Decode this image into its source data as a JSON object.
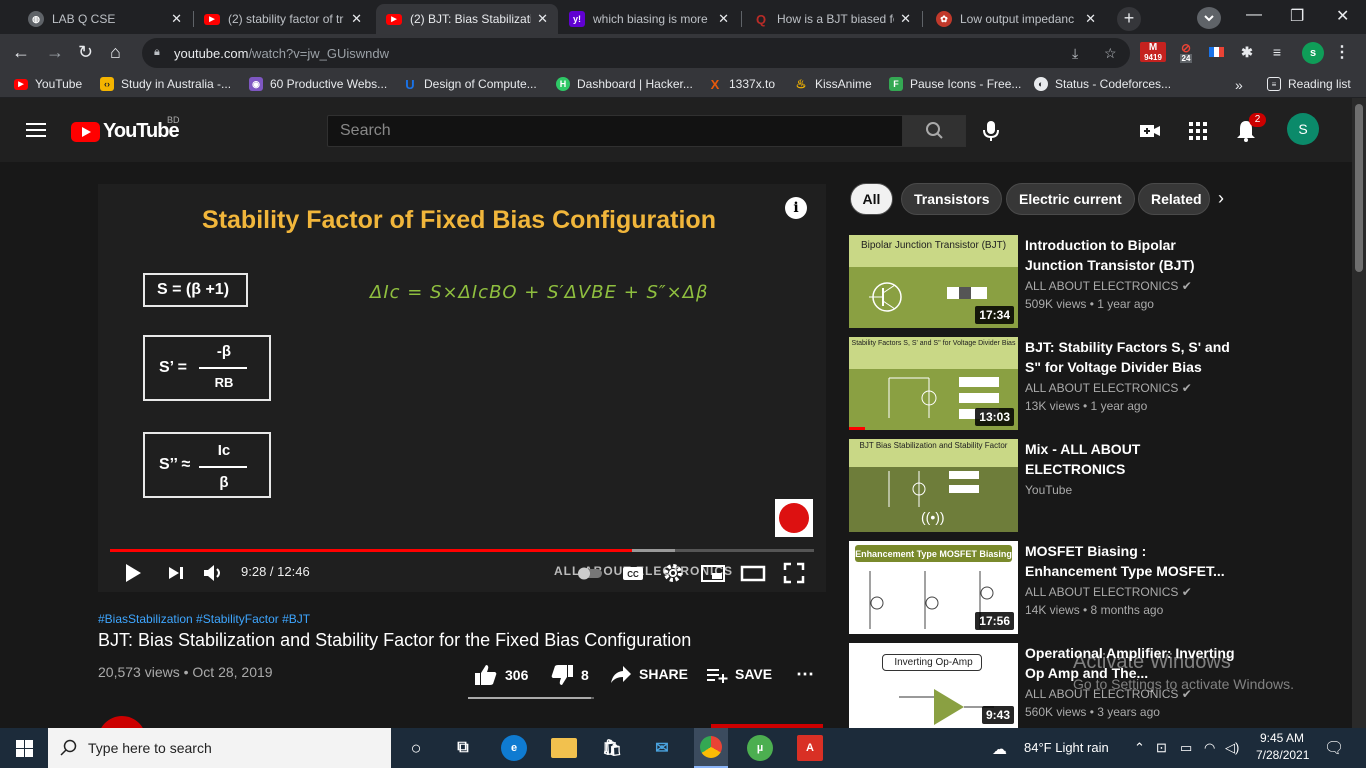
{
  "browser": {
    "tabs": [
      {
        "title": "LAB Q CSE",
        "favicon": "globe-icon",
        "active": false
      },
      {
        "title": "(2) stability factor of tr",
        "favicon": "youtube-icon",
        "active": false
      },
      {
        "title": "(2) BJT: Bias Stabilizatic",
        "favicon": "youtube-icon",
        "active": true
      },
      {
        "title": "which biasing is more",
        "favicon": "yahoo-icon",
        "active": false
      },
      {
        "title": "How is a BJT biased fo",
        "favicon": "quora-icon",
        "active": false
      },
      {
        "title": "Low output impedanc",
        "favicon": "electronics-icon",
        "active": false
      }
    ],
    "url_domain": "youtube.com",
    "url_path": "/watch?v=jw_GUiswndw",
    "ext_gmail_count": "9419",
    "ext_badge_count": "24",
    "profile_initial": "s",
    "bookmarks": [
      {
        "label": "YouTube",
        "icon": "youtube-icon",
        "color": "#ff0000"
      },
      {
        "label": "Study in Australia -...",
        "icon": "study-icon",
        "color": "#f4b400"
      },
      {
        "label": "60 Productive Webs...",
        "icon": "web-icon",
        "color": "#7e57c2"
      },
      {
        "label": "Design of Compute...",
        "icon": "udemy-icon",
        "color": "#1a73e8"
      },
      {
        "label": "Dashboard | Hacker...",
        "icon": "hackerrank-icon",
        "color": "#2ec866"
      },
      {
        "label": "1337x.to",
        "icon": "x-icon",
        "color": "#e8590c"
      },
      {
        "label": "KissAnime",
        "icon": "kiss-icon",
        "color": "#f4b400"
      },
      {
        "label": "Pause Icons - Free...",
        "icon": "flaticon-icon",
        "color": "#34a853"
      },
      {
        "label": "Status - Codeforces...",
        "icon": "codeforces-icon",
        "color": "#e8eaed"
      }
    ],
    "overflow_label": "»",
    "reading_list": "Reading list"
  },
  "youtube": {
    "logo_text": "YouTube",
    "country_code": "BD",
    "search_placeholder": "Search",
    "notif_count": "2",
    "avatar_initial": "S",
    "video": {
      "slide_title": "Stability Factor of Fixed Bias Configuration",
      "box1": "S = (β +1)",
      "box2_lhs": "S’ =",
      "box2_num": "-β",
      "box2_den": "RB",
      "box3_lhs": "S’’ ≈",
      "box3_num": "Ic",
      "box3_den": "β",
      "handwritten": "ΔIc =  S×ΔIcBO + S′ΔVBE + S″×Δβ",
      "watermark_text": "ALL ABOUT ELECTRONICS",
      "current_time": "9:28",
      "duration": "12:46",
      "time_display": "9:28 / 12:46",
      "played_fraction": 0.742,
      "buffered_fraction": 0.803
    },
    "hashtags": "#BiasStabilization #StabilityFactor #BJT",
    "title": "BJT: Bias Stabilization and Stability Factor for the Fixed Bias Configuration",
    "views": "20,573 views",
    "date": "Oct 28, 2019",
    "likes": "306",
    "dislikes": "8",
    "share_label": "SHARE",
    "save_label": "SAVE",
    "chips": [
      "All",
      "Transistors",
      "Electric current",
      "Related"
    ],
    "recommendations": [
      {
        "title": "Introduction to Bipolar Junction Transistor (BJT)",
        "channel": "ALL ABOUT ELECTRONICS",
        "meta": "509K views • 1 year ago",
        "duration": "17:34",
        "thumb_text": "Bipolar Junction Transistor (BJT)"
      },
      {
        "title": "BJT: Stability Factors S, S' and S\" for Voltage Divider Bias",
        "channel": "ALL ABOUT ELECTRONICS",
        "meta": "13K views • 1 year ago",
        "duration": "13:03",
        "thumb_text": "Stability Factors S, S' and S'' for Voltage Divider Bias"
      },
      {
        "title": "Mix - ALL ABOUT ELECTRONICS",
        "channel": "YouTube",
        "meta": "",
        "duration": "",
        "thumb_text": "BJT Bias Stabilization and Stability Factor"
      },
      {
        "title": "MOSFET Biasing : Enhancement Type MOSFET...",
        "channel": "ALL ABOUT ELECTRONICS",
        "meta": "14K views • 8 months ago",
        "duration": "17:56",
        "thumb_text": "Enhancement Type MOSFET Biasing"
      },
      {
        "title": "Operational Amplifier: Inverting Op Amp and The...",
        "channel": "ALL ABOUT ELECTRONICS",
        "meta": "560K views • 3 years ago",
        "duration": "9:43",
        "thumb_text": "Inverting Op-Amp"
      }
    ]
  },
  "os": {
    "activate_title": "Activate Windows",
    "activate_sub": "Go to Settings to activate Windows.",
    "search_text": "Type here to search",
    "weather": "84°F  Light rain",
    "time": "9:45 AM",
    "date": "7/28/2021"
  },
  "colors": {
    "accent_red": "#ff0000",
    "slide_title": "#f1b63b",
    "handwriting": "#8fbf3f",
    "link_blue": "#3ea6ff"
  }
}
